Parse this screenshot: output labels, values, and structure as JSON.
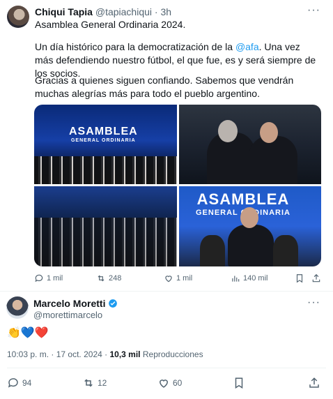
{
  "quoted_post": {
    "author_name": "Chiqui Tapia",
    "author_handle": "@tapiachiqui",
    "separator": "·",
    "time_ago": "3h",
    "more_icon": "more-horizontal-icon",
    "line1": "Asamblea General Ordinaria 2024.",
    "para1_before_mention": "Un día histórico para la democratización de la ",
    "para1_mention": "@afa",
    "para1_after_mention": ". Una vez más defendiendo nuestro fútbol, el que fue, es y será siempre de los socios.",
    "para2": "Gracias a quienes siguen confiando. Sabemos que vendrán muchas alegrías más para todo el pueblo argentino.",
    "photos": {
      "banner_main": "ASAMBLEA",
      "banner_sub": "GENERAL ORDINARIA",
      "banner_sub_alt": "GENERAL ORDINARIA"
    },
    "stats": {
      "replies": "1 mil",
      "reposts": "248",
      "likes": "1 mil",
      "views": "140 mil"
    }
  },
  "main_post": {
    "author_name": "Marcelo Moretti",
    "author_handle": "@morettimarcelo",
    "verified_color": "#1d9bf0",
    "emoji_text": "👏💙❤️",
    "time": "10:03 p. m.",
    "separator": "·",
    "date": "17 oct. 2024",
    "views_count": "10,3 mil",
    "views_label": "Reproducciones",
    "stats": {
      "replies": "94",
      "reposts": "12",
      "likes": "60"
    }
  },
  "colors": {
    "text_primary": "#0f1419",
    "text_secondary": "#536471",
    "accent": "#1d9bf0"
  }
}
